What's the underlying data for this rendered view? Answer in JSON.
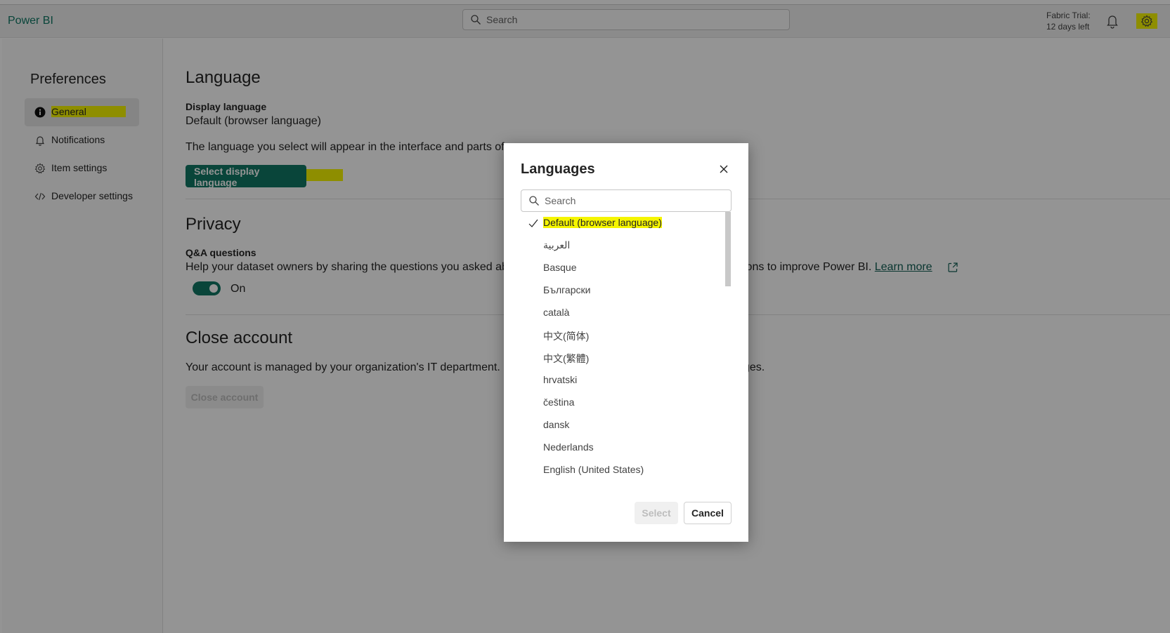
{
  "topbar": {
    "brand": "Power BI",
    "search_placeholder": "Search",
    "trial_line1": "Fabric Trial:",
    "trial_line2": "12 days left"
  },
  "sidebar": {
    "title": "Preferences",
    "items": [
      {
        "label": "General",
        "icon": "info-icon",
        "active": true
      },
      {
        "label": "Notifications",
        "icon": "bell-icon"
      },
      {
        "label": "Item settings",
        "icon": "gear-icon"
      },
      {
        "label": "Developer settings",
        "icon": "code-icon"
      }
    ]
  },
  "main": {
    "language": {
      "heading": "Language",
      "display_label": "Display language",
      "display_value": "Default (browser language)",
      "description": "The language you select will appear in the interface and parts of",
      "button": "Select display language"
    },
    "privacy": {
      "heading": "Privacy",
      "qa_label": "Q&A questions",
      "description_start": "Help your dataset owners by sharing the questions you asked ab",
      "description_end": "ions to improve Power BI.",
      "learn_more": "Learn more",
      "toggle_state": "On"
    },
    "close_account": {
      "heading": "Close account",
      "description_start": "Your account is managed by your organization's IT department. F",
      "description_end": "ges.",
      "button": "Close account"
    }
  },
  "modal": {
    "title": "Languages",
    "search_placeholder": "Search",
    "items": [
      {
        "label": "Default (browser language)",
        "selected": true
      },
      {
        "label": "العربية"
      },
      {
        "label": "Basque"
      },
      {
        "label": "Български"
      },
      {
        "label": "català"
      },
      {
        "label": "中文(简体)"
      },
      {
        "label": "中文(繁體)"
      },
      {
        "label": "hrvatski"
      },
      {
        "label": "čeština"
      },
      {
        "label": "dansk"
      },
      {
        "label": "Nederlands"
      },
      {
        "label": "English (United States)"
      }
    ],
    "select_label": "Select",
    "cancel_label": "Cancel"
  }
}
